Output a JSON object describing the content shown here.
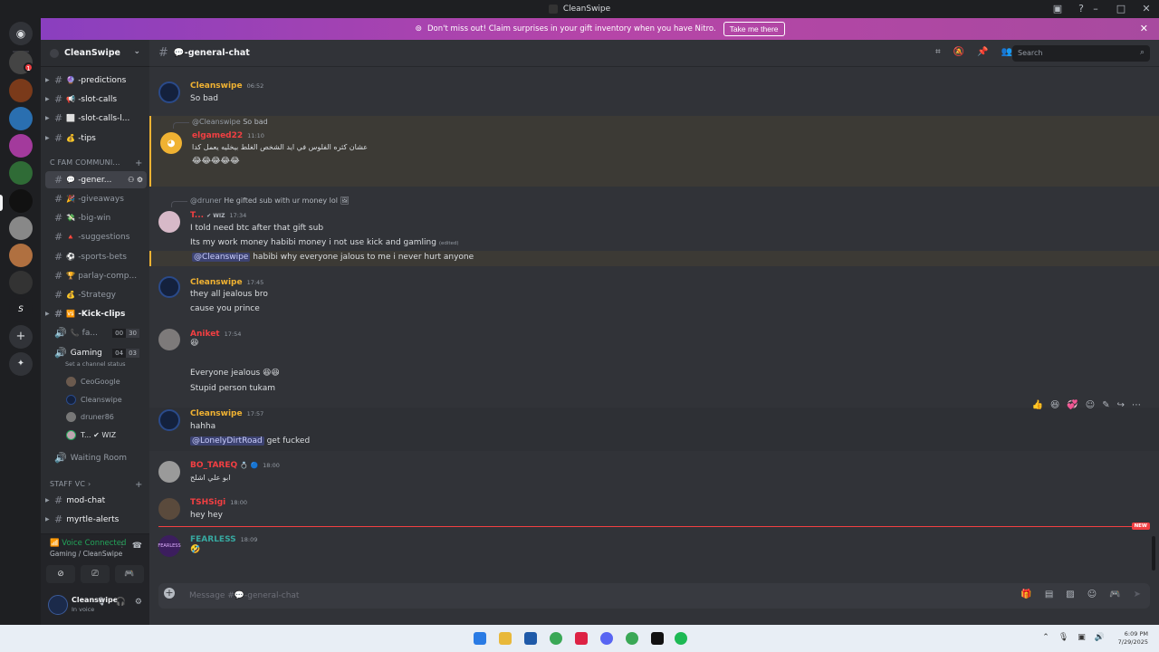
{
  "window": {
    "title": "CleanSwipe"
  },
  "banner": {
    "text": "Don't miss out! Claim surprises in your gift inventory when you have Nitro.",
    "button": "Take me there"
  },
  "server": {
    "name": "CleanSwipe"
  },
  "sidebar": {
    "channels_top": [
      {
        "label": "-predictions",
        "emoji": "🔮"
      },
      {
        "label": "-slot-calls",
        "emoji": "📢"
      },
      {
        "label": "-slot-calls-l...",
        "emoji": "⬜"
      },
      {
        "label": "-tips",
        "emoji": "💰"
      }
    ],
    "category_community": "C FAM COMMUNI...",
    "channels_community": [
      {
        "label": "-gener...",
        "emoji": "💬"
      },
      {
        "label": "-giveaways",
        "emoji": "🎉"
      },
      {
        "label": "-big-win",
        "emoji": "💸"
      },
      {
        "label": "-suggestions",
        "emoji": "🔺"
      },
      {
        "label": "-sports-bets",
        "emoji": "⚽"
      },
      {
        "label": "parlay-comp...",
        "emoji": "🏆"
      },
      {
        "label": "-Strategy",
        "emoji": "💰"
      },
      {
        "label": "-Kick-clips",
        "emoji": "🆚"
      }
    ],
    "voice_fa": {
      "label": "fa...",
      "count_a": "00",
      "count_b": "30"
    },
    "voice_gaming": {
      "label": "Gaming",
      "count_a": "04",
      "count_b": "03",
      "status": "Set a channel status"
    },
    "voice_users": [
      "CeoGoogle",
      "Cleanswipe",
      "druner86",
      "T... ✔ WIZ"
    ],
    "waiting_room": "Waiting Room",
    "category_staff": "STAFF VC",
    "channels_staff": [
      "mod-chat",
      "myrtle-alerts"
    ]
  },
  "voice": {
    "status": "Voice Connected",
    "location": "Gaming / CleanSwipe"
  },
  "user": {
    "name": "Cleanswipe",
    "status": "In voice"
  },
  "channel": {
    "name": "-general-chat",
    "emoji": "💬"
  },
  "search": {
    "placeholder": "Search"
  },
  "messages": {
    "m1": {
      "author": "Cleanswipe",
      "time": "06:52",
      "text": "So bad"
    },
    "m2": {
      "reply_to": "@Cleanswipe",
      "reply_text": "So bad",
      "author": "elgamed22",
      "time": "11:10",
      "text": "عشان كثره الفلوس في ايد الشخص الغلط بيخليه يعمل كدا",
      "emoji": "😂😂😂😂😂"
    },
    "m3": {
      "reply_to": "@druner",
      "reply_text": "He gifted sub with ur money lol 🖼",
      "author": "T...",
      "tag": "✔ WIZ",
      "time": "17:34",
      "line1": "I told need btc after that gift sub",
      "line2": "Its my work money habibi money i not use kick and gamling",
      "edited": "(edited)",
      "mention": "@Cleanswipe",
      "line3": "habibi why everyone jalous to me i never hurt anyone"
    },
    "m4": {
      "author": "Cleanswipe",
      "time": "17:45",
      "line1": "they all jealous bro",
      "line2": "cause you prince"
    },
    "m5": {
      "author": "Aniket",
      "time": "17:54",
      "emoji": "😆",
      "line1": "Everyone jealous 😆😆",
      "line2": "Stupid person tukam"
    },
    "m6": {
      "author": "Cleanswipe",
      "time": "17:57",
      "line1": "hahha",
      "mention": "@LonelyDirtRoad",
      "line2": "get fucked"
    },
    "m7": {
      "author": "BO_TAREQ",
      "time": "18:00",
      "text": "ابو علي اشلح"
    },
    "m8": {
      "author": "TSHSigi",
      "time": "18:00",
      "text": "hey hey"
    },
    "m9": {
      "author": "FEARLESS",
      "time": "18:09",
      "emoji": "🤣"
    }
  },
  "new_tag": "NEW",
  "composer": {
    "placeholder": "Message #💬-general-chat"
  },
  "taskbar": {
    "time": "6:09 PM",
    "date": "7/29/2025"
  }
}
